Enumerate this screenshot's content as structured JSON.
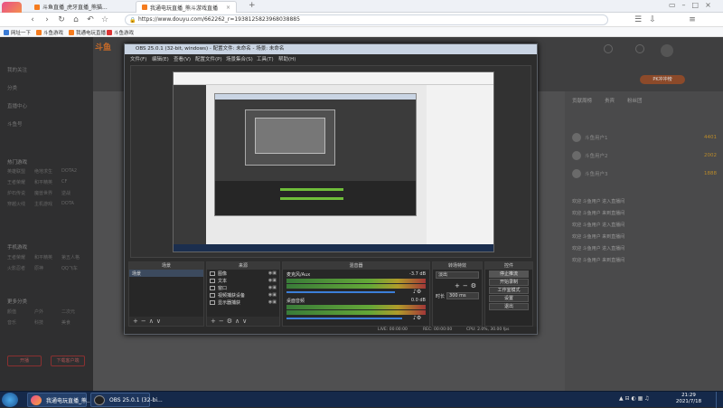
{
  "browser": {
    "brand_label": "斗鱼极速",
    "tabs": [
      {
        "label": "斗鱼直播_虎牙直播_熊猫...",
        "active": false
      },
      {
        "label": "我通电玩直播_熊斗游戏直播",
        "active": true
      }
    ],
    "url": "https://www.douyu.com/662262_r=1938125823968038885",
    "bookmarks": [
      "网址一下",
      "斗鱼游戏",
      "我通电玩直播",
      "斗鱼游戏"
    ]
  },
  "page": {
    "logo": "斗鱼",
    "left_nav": {
      "items": [
        "我的关注",
        "分类",
        "直播中心",
        "斗鱼号"
      ],
      "section_hot": "热门游戏",
      "hot_games": [
        "英雄联盟",
        "绝地求生",
        "DOTA2",
        "王者荣耀",
        "和平精英",
        "CF",
        "炉石传说",
        "魔兽世界",
        "逆战",
        "穿越火线",
        "主机游戏",
        "DOTA"
      ],
      "section_mobile": "手机游戏",
      "mobile_games": [
        "王者荣耀",
        "和平精英",
        "第五人格",
        "火影忍者",
        "原神",
        "QQ飞车"
      ],
      "section_more": "更多分类",
      "more_games": [
        "颜值",
        "户外",
        "二次元",
        "音乐",
        "科技",
        "美食"
      ],
      "buttons": [
        "开播",
        "下载客户端"
      ]
    },
    "right_panel": {
      "pk_label": "PK冲冲榜",
      "tabs": [
        "贡献周榜",
        "贵宾",
        "粉丝团"
      ],
      "ranks": [
        {
          "name": "斗鱼用户1",
          "score": "4401"
        },
        {
          "name": "斗鱼用户2",
          "score": "2002"
        },
        {
          "name": "斗鱼用户3",
          "score": "1888"
        }
      ],
      "messages": [
        "欢迎 斗鱼用户 进入直播间",
        "欢迎 斗鱼用户 来到直播间",
        "欢迎 斗鱼用户 进入直播间",
        "欢迎 斗鱼用户 来到直播间",
        "欢迎 斗鱼用户 进入直播间",
        "欢迎 斗鱼用户 来到直播间"
      ]
    }
  },
  "obs": {
    "title": "OBS 25.0.1 (32-bit, windows) - 配置文件: 未命名 - 场景: 未命名",
    "menu": [
      "文件(F)",
      "编辑(E)",
      "查看(V)",
      "配置文件(P)",
      "场景集合(S)",
      "工具(T)",
      "帮助(H)"
    ],
    "docks": {
      "scenes": {
        "title": "场景",
        "items": [
          "场景"
        ]
      },
      "sources": {
        "title": "来源",
        "items": [
          "图像",
          "文本",
          "窗口",
          "视频捕获设备",
          "显示器捕获"
        ]
      },
      "mixer": {
        "title": "混音器",
        "channels": [
          {
            "name": "麦克风/Aux",
            "db": "-3.7 dB"
          },
          {
            "name": "桌面音频",
            "db": "0.0 dB"
          }
        ]
      },
      "transitions": {
        "title": "转场特效",
        "type": "淡出",
        "duration_label": "时长",
        "duration": "300 ms"
      },
      "controls": {
        "title": "控件",
        "buttons": [
          "停止推流",
          "开始录制",
          "工作室模式",
          "设置",
          "退出"
        ]
      }
    },
    "status": {
      "live": "LIVE: 00:00:00",
      "rec": "REC: 00:00:00",
      "cpu": "CPU: 2.0%, 30.00 fps"
    }
  },
  "taskbar": {
    "items": [
      "我通电玩直播_熊...",
      "OBS 25.0.1 (32-bi..."
    ],
    "time": "21:29",
    "date": "2021/7/18"
  }
}
